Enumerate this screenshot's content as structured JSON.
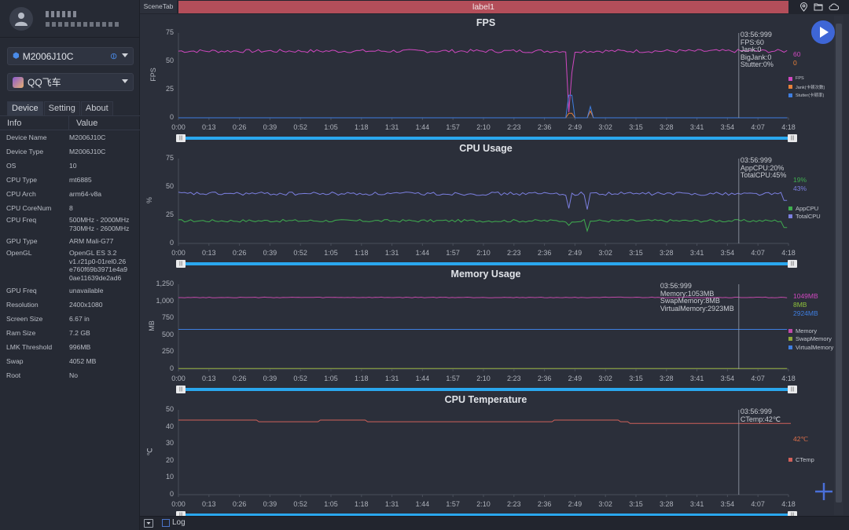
{
  "sidebar": {
    "device_select": "M2006J10C",
    "app_select": "QQ飞车",
    "tabs": [
      "Device",
      "Setting",
      "About"
    ],
    "active_tab": "Device",
    "info_header": {
      "info": "Info",
      "value": "Value"
    },
    "info_rows": [
      {
        "k": "Device Name",
        "v": "M2006J10C"
      },
      {
        "k": "Device Type",
        "v": "M2006J10C"
      },
      {
        "k": "OS",
        "v": "10"
      },
      {
        "k": "CPU Type",
        "v": "mt6885"
      },
      {
        "k": "CPU Arch",
        "v": "arm64-v8a"
      },
      {
        "k": "CPU CoreNum",
        "v": "8"
      },
      {
        "k": "CPU Freq",
        "v": "500MHz - 2000MHz\n730MHz - 2600MHz"
      },
      {
        "k": "GPU Type",
        "v": "ARM Mali-G77"
      },
      {
        "k": "OpenGL",
        "v": "OpenGL ES 3.2\nv1.r21p0-01rel0.26\ne760f69b3971e4a9\n0ae11639de2ad6"
      },
      {
        "k": "GPU Freq",
        "v": "unavailable"
      },
      {
        "k": "Resolution",
        "v": "2400x1080"
      },
      {
        "k": "Screen Size",
        "v": "6.67 in"
      },
      {
        "k": "Ram Size",
        "v": "7.2 GB"
      },
      {
        "k": "LMK Threshold",
        "v": "996MB"
      },
      {
        "k": "Swap",
        "v": "4052 MB"
      },
      {
        "k": "Root",
        "v": "No"
      }
    ]
  },
  "topbar": {
    "scene_tab": "SceneTab",
    "label": "label1",
    "icons": [
      "location-icon",
      "folder-icon",
      "cloud-icon"
    ]
  },
  "bottombar": {
    "log_label": "Log",
    "log_checked": false
  },
  "cursor_time": "03:56:999",
  "x_ticks": [
    "0:00",
    "0:13",
    "0:26",
    "0:39",
    "0:52",
    "1:05",
    "1:18",
    "1:31",
    "1:44",
    "1:57",
    "2:10",
    "2:23",
    "2:36",
    "2:49",
    "3:02",
    "3:15",
    "3:28",
    "3:41",
    "3:54",
    "4:07",
    "4:18"
  ],
  "chart_data": [
    {
      "type": "line",
      "title": "FPS",
      "ylabel": "FPS",
      "yticks": [
        "0",
        "25",
        "50",
        "75"
      ],
      "ylim": [
        0,
        75
      ],
      "xlim_seconds": [
        0,
        258
      ],
      "cursor_seconds": 237,
      "tooltip": "03:56:999\nFPS:60\nJank:0\nBigJank:0\nStutter:0%",
      "current_values": [
        {
          "text": "60",
          "color": "#d048c0"
        },
        {
          "text": "0",
          "color": "#e8813a"
        }
      ],
      "series": [
        {
          "name": "FPS",
          "color": "#d048c0",
          "baseline": 59,
          "noise": 1.5,
          "events": [
            [
              165,
              0
            ],
            [
              166,
              5
            ],
            [
              167,
              40
            ],
            [
              168,
              58
            ]
          ]
        },
        {
          "name": "Jank(卡顿次数)",
          "color": "#e8813a",
          "baseline": 0,
          "events": [
            [
              165,
              10
            ],
            [
              166,
              4
            ],
            [
              174,
              6
            ]
          ]
        },
        {
          "name": "Stutter(卡顿率)",
          "color": "#3f7ee0",
          "baseline": 0,
          "events": [
            [
              165,
              40
            ],
            [
              166,
              20
            ],
            [
              174,
              10
            ]
          ]
        }
      ]
    },
    {
      "type": "line",
      "title": "CPU Usage",
      "ylabel": "%",
      "yticks": [
        "0",
        "25",
        "50",
        "75"
      ],
      "ylim": [
        0,
        75
      ],
      "xlim_seconds": [
        0,
        258
      ],
      "cursor_seconds": 237,
      "tooltip": "03:56:999\nAppCPU:20%\nTotalCPU:45%",
      "current_values": [
        {
          "text": "19%",
          "color": "#3fae4f"
        },
        {
          "text": "43%",
          "color": "#7b7fe0"
        }
      ],
      "series": [
        {
          "name": "AppCPU",
          "color": "#3fae4f",
          "baseline": 20,
          "noise": 1.2,
          "events": [
            [
              165,
              16
            ],
            [
              173,
              11
            ],
            [
              257,
              14
            ]
          ]
        },
        {
          "name": "TotalCPU",
          "color": "#7b7fe0",
          "baseline": 44,
          "noise": 1.5,
          "events": [
            [
              165,
              31
            ],
            [
              173,
              30
            ],
            [
              257,
              38
            ]
          ]
        }
      ]
    },
    {
      "type": "line",
      "title": "Memory Usage",
      "ylabel": "MB",
      "yticks": [
        "0",
        "250",
        "500",
        "750",
        "1,000",
        "1,250"
      ],
      "ylim": [
        0,
        1250
      ],
      "xlim_seconds": [
        0,
        258
      ],
      "cursor_seconds": 237,
      "tooltip": "03:56:999\nMemory:1053MB\nSwapMemory:8MB\nVirtualMemory:2923MB",
      "current_values": [
        {
          "text": "1049MB",
          "color": "#d048c0"
        },
        {
          "text": "8MB",
          "color": "#8fc23a"
        },
        {
          "text": "2924MB",
          "color": "#3f7ee0"
        }
      ],
      "series": [
        {
          "name": "Memory",
          "color": "#c04aa8",
          "baseline": 1055,
          "noise": 5
        },
        {
          "name": "SwapMemory",
          "color": "#8fa83a",
          "baseline": 8,
          "noise": 0
        },
        {
          "name": "VirtualMemory",
          "color": "#3f7ee0",
          "baseline": 585,
          "noise": 0
        }
      ]
    },
    {
      "type": "line",
      "title": "CPU Temperature",
      "ylabel": "℃",
      "yticks": [
        "0",
        "10",
        "20",
        "30",
        "40",
        "50"
      ],
      "ylim": [
        0,
        50
      ],
      "xlim_seconds": [
        0,
        258
      ],
      "cursor_seconds": 237,
      "tooltip": "03:56:999\nCTemp:42℃",
      "current_values": [
        {
          "text": "42℃",
          "color": "#e0704a"
        }
      ],
      "series": [
        {
          "name": "CTemp",
          "color": "#d0605a",
          "steps": [
            [
              0,
              44
            ],
            [
              33,
              43
            ],
            [
              59,
              44
            ],
            [
              79,
              43
            ],
            [
              158,
              44
            ],
            [
              186,
              43
            ],
            [
              190,
              42
            ],
            [
              258,
              42
            ]
          ]
        }
      ]
    }
  ]
}
